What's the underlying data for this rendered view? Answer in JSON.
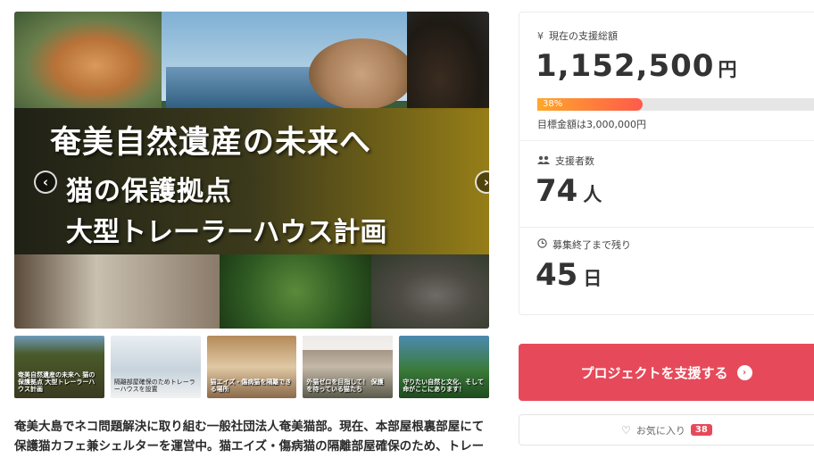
{
  "hero": {
    "title_line1": "奄美自然遺産の未来へ",
    "title_line2": "猫の保護拠点",
    "title_line3": "大型トレーラーハウス計画",
    "prev_icon": "chevron-left-icon",
    "next_icon": "chevron-right-icon"
  },
  "thumbnails": [
    {
      "caption": "奄美自然遺産の未来へ 猫の保護拠点 大型トレーラーハウス計画"
    },
    {
      "caption": "隔離部屋確保のためトレーラーハウスを設置"
    },
    {
      "caption": "猫エイズ・傷病猫を隔離できる場所"
    },
    {
      "caption": "外猫ゼロを目指して！ 保護を待っている猫たち"
    },
    {
      "caption": "守りたい自然と文化、そして命がここにあります！"
    }
  ],
  "description": "奄美大島でネコ問題解決に取り組む一般社団法人奄美猫部。現在、本部屋根裏部屋にて保護猫カフェ兼シェルターを運営中。猫エイズ・傷病猫の隔離部屋確保のため、トレーラー",
  "stats": {
    "total_label": "現在の支援総額",
    "total_icon": "yen-icon",
    "total_amount": "1,152,500",
    "total_unit": "円",
    "progress_percent_text": "38%",
    "progress_value": 38,
    "goal_text": "目標金額は3,000,000円",
    "supporters_label": "支援者数",
    "supporters_icon": "people-icon",
    "supporters_count": "74",
    "supporters_unit": "人",
    "remaining_label": "募集終了まで残り",
    "remaining_icon": "clock-icon",
    "remaining_days": "45",
    "remaining_unit": "日"
  },
  "cta": {
    "label": "プロジェクトを支援する",
    "icon": "arrow-circle-right-icon"
  },
  "favorite": {
    "label": "お気に入り",
    "count": "38",
    "icon": "heart-icon"
  },
  "colors": {
    "accent": "#e64a5a",
    "progress_start": "#ffa72b",
    "progress_end": "#ff5a4a"
  }
}
